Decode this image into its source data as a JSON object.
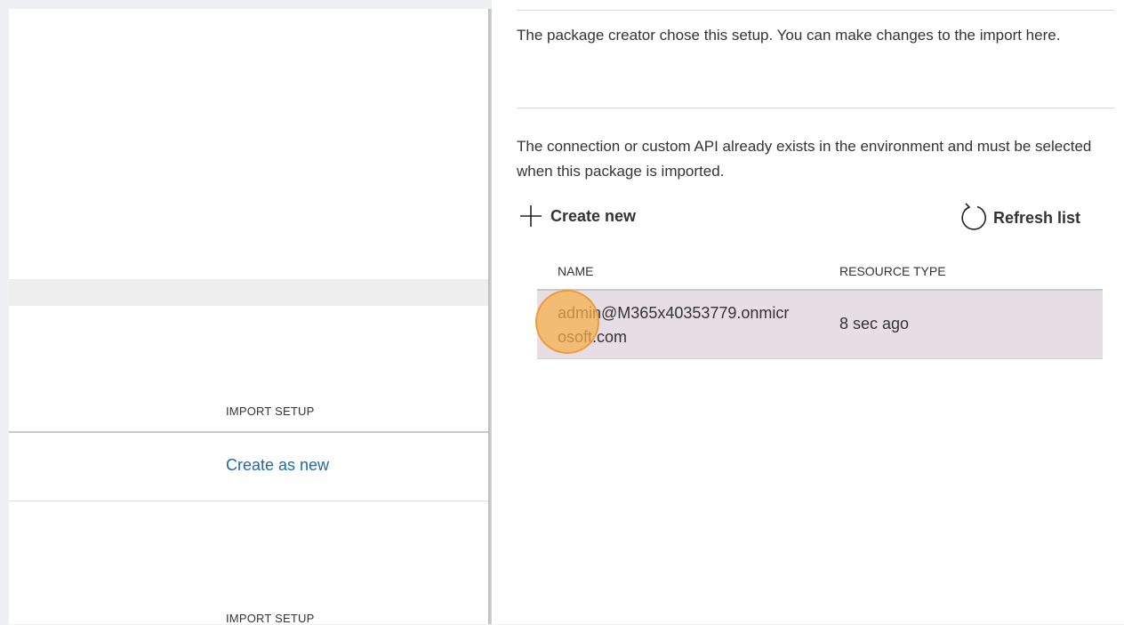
{
  "left": {
    "import_setup_header_1": "IMPORT SETUP",
    "import_setup_value_1": "Create as new",
    "import_setup_header_2": "IMPORT SETUP"
  },
  "right": {
    "intro_text": "The package creator chose this setup. You can make changes to the import here.",
    "connection_text": "The connection or custom API already exists in the environment and must be selected when this package is imported.",
    "create_new_label": "Create new",
    "refresh_list_label": "Refresh list",
    "table": {
      "columns": [
        "NAME",
        "RESOURCE TYPE"
      ],
      "rows": [
        {
          "name": "admin@M365x40353779.onmicrosoft.com",
          "resource_type": "8 sec ago"
        }
      ]
    }
  },
  "icons": {
    "create_new": "plus-icon",
    "refresh": "refresh-icon"
  },
  "colors": {
    "link": "#1e6aa3",
    "selected_row": "#e6dde5",
    "click_marker": "#f7af48"
  }
}
